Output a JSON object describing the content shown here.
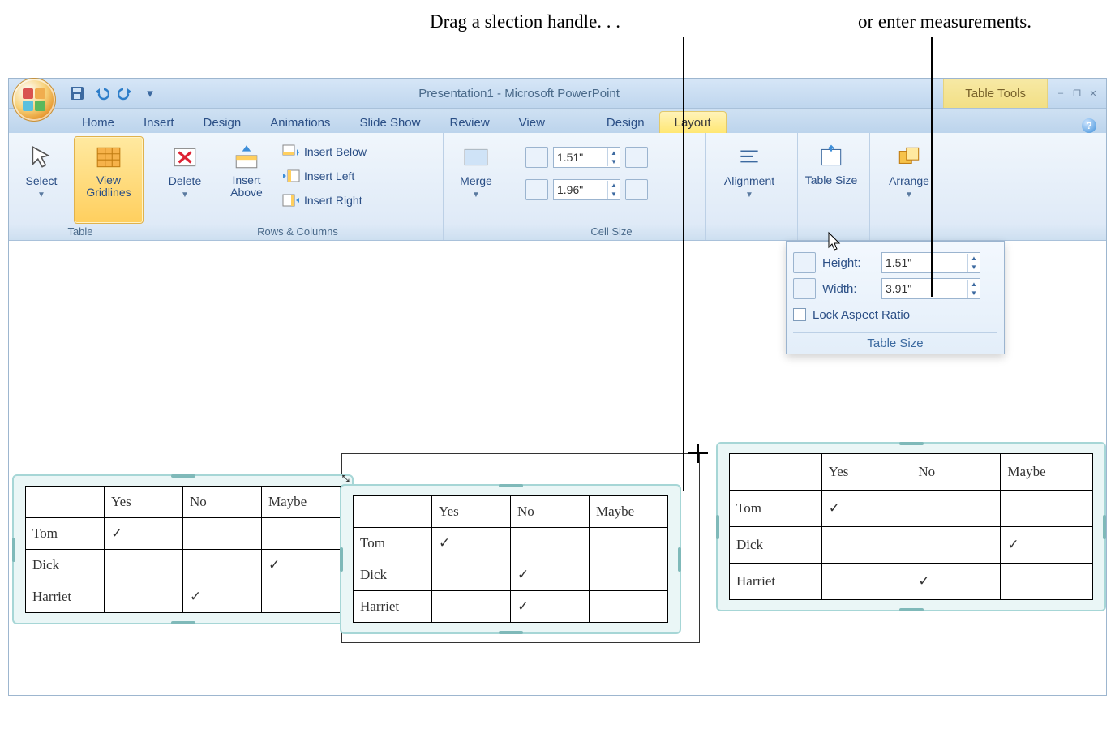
{
  "callouts": {
    "left": "Drag a slection handle. . .",
    "right": "or enter measurements."
  },
  "titlebar": {
    "app_title": "Presentation1 - Microsoft PowerPoint",
    "context_label": "Table Tools"
  },
  "tabs": {
    "items": [
      "Home",
      "Insert",
      "Design",
      "Animations",
      "Slide Show",
      "Review",
      "View",
      "Design",
      "Layout"
    ],
    "active_index": 8
  },
  "ribbon": {
    "table_group": {
      "label": "Table",
      "select": "Select",
      "gridlines": "View Gridlines"
    },
    "rows_cols_group": {
      "label": "Rows & Columns",
      "delete": "Delete",
      "insert_above": "Insert Above",
      "insert_below": "Insert Below",
      "insert_left": "Insert Left",
      "insert_right": "Insert Right"
    },
    "merge_group": {
      "label": "",
      "merge": "Merge"
    },
    "cell_size_group": {
      "label": "Cell Size",
      "height": "1.51\"",
      "width": "1.96\""
    },
    "alignment_group": {
      "alignment": "Alignment"
    },
    "table_size_group": {
      "table_size": "Table Size"
    },
    "arrange_group": {
      "arrange": "Arrange"
    }
  },
  "popup": {
    "height_label": "Height:",
    "height_value": "1.51\"",
    "width_label": "Width:",
    "width_value": "3.91\"",
    "lock_label": "Lock Aspect Ratio",
    "title": "Table Size"
  },
  "demo_tables": {
    "headers": [
      "",
      "Yes",
      "No",
      "Maybe"
    ],
    "rows": [
      {
        "name": "Tom",
        "yes": "✓",
        "no": "",
        "maybe": ""
      },
      {
        "name": "Dick",
        "yes": "",
        "no": "",
        "maybe": "✓"
      },
      {
        "name": "Harriet",
        "yes": "",
        "no": "✓",
        "maybe": ""
      }
    ],
    "t2_rows": [
      {
        "name": "Tom",
        "yes": "✓",
        "no": "",
        "maybe": ""
      },
      {
        "name": "Dick",
        "yes": "",
        "no": "✓",
        "maybe": ""
      },
      {
        "name": "Harriet",
        "yes": "",
        "no": "✓",
        "maybe": ""
      }
    ]
  }
}
